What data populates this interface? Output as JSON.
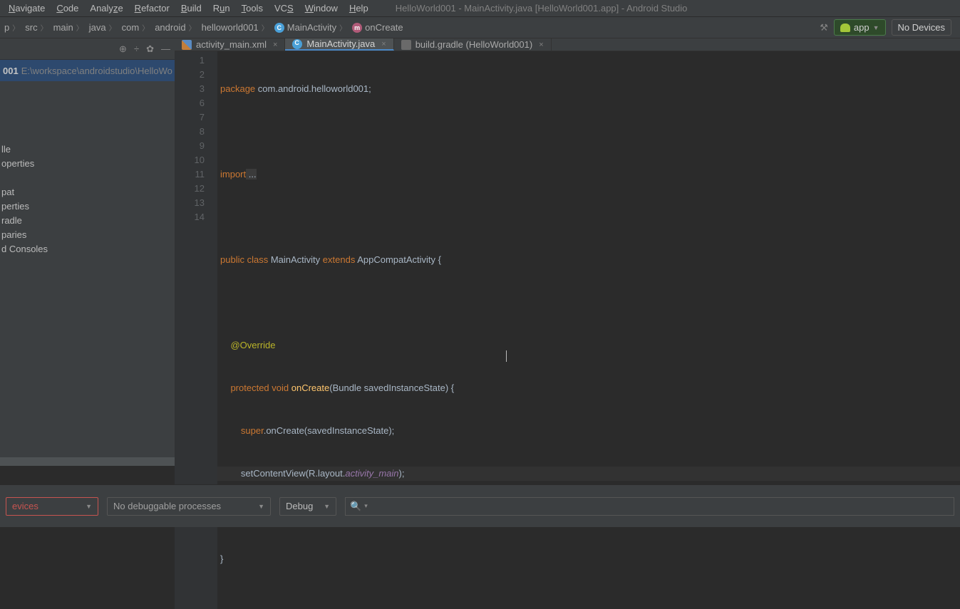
{
  "menu": {
    "items": [
      "Navigate",
      "Code",
      "Analyze",
      "Refactor",
      "Build",
      "Run",
      "Tools",
      "VCS",
      "Window",
      "Help"
    ],
    "title": "HelloWorld001 - MainActivity.java [HelloWorld001.app] - Android Studio"
  },
  "breadcrumbs": {
    "p": "p",
    "src": "src",
    "main": "main",
    "java": "java",
    "com": "com",
    "android": "android",
    "hw": "helloworld001",
    "cls": "MainActivity",
    "mth": "onCreate"
  },
  "nav": {
    "app": "app",
    "nodevices": "No Devices"
  },
  "project": {
    "name": "001",
    "path": "E:\\workspace\\androidstudio\\HelloWo"
  },
  "sidebar": {
    "items": [
      "lle",
      "operties",
      "",
      "pat",
      "perties",
      "radle",
      "paries",
      "d Consoles"
    ]
  },
  "tabs": {
    "t0": "activity_main.xml",
    "t1": "MainActivity.java",
    "t2": "build.gradle (HelloWorld001)"
  },
  "lines": [
    "1",
    "2",
    "3",
    "6",
    "7",
    "8",
    "9",
    "10",
    "11",
    "12",
    "13",
    "14"
  ],
  "code": {
    "l1": {
      "kw": "package",
      "pk": " com.android.helloworld001;"
    },
    "l3": {
      "kw": "import",
      "dots": " ..."
    },
    "l7a": "public ",
    "l7b": "class ",
    "l7c": "MainActivity ",
    "l7d": "extends ",
    "l7e": "AppCompatActivity {",
    "l9": "@Override",
    "l10a": "protected ",
    "l10b": "void ",
    "l10c": "onCreate",
    "l10d": "(Bundle savedInstanceState) {",
    "l11a": "super",
    "l11b": ".onCreate(savedInstanceState);",
    "l12a": "setContentView(R.layout.",
    "l12b": "activity_main",
    "l12c": ");",
    "l13": "}",
    "l14": "}"
  },
  "debug": {
    "devices": "evices",
    "proc": "No debuggable processes",
    "mode": "Debug",
    "search": ""
  }
}
